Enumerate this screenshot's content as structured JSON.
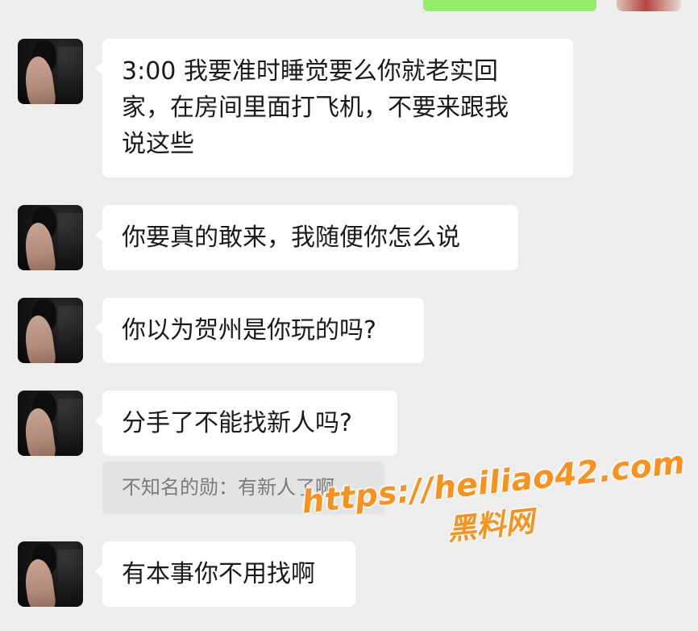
{
  "chat": {
    "messages": [
      {
        "sender_avatar": "contact-avatar",
        "text_lines": [
          "3:00 我要准时睡觉要么你就老实回",
          "家，在房间里面打飞机，不要来跟我",
          "说这些"
        ]
      },
      {
        "sender_avatar": "contact-avatar",
        "text": "你要真的敢来，我随便你怎么说"
      },
      {
        "sender_avatar": "contact-avatar",
        "text": "你以为贺州是你玩的吗?"
      },
      {
        "sender_avatar": "contact-avatar",
        "text": "分手了不能找新人吗?",
        "quote": "不知名的勋：有新人了啊"
      },
      {
        "sender_avatar": "contact-avatar",
        "text": "有本事你不用找啊"
      }
    ]
  },
  "watermark": {
    "url": "https://heiliao42.com",
    "site_name": "黑料网"
  },
  "colors": {
    "background": "#ededed",
    "incoming_bubble": "#ffffff",
    "outgoing_bubble": "#95ec69",
    "quote_background": "#e3e3e3",
    "watermark": "#f7921e"
  }
}
